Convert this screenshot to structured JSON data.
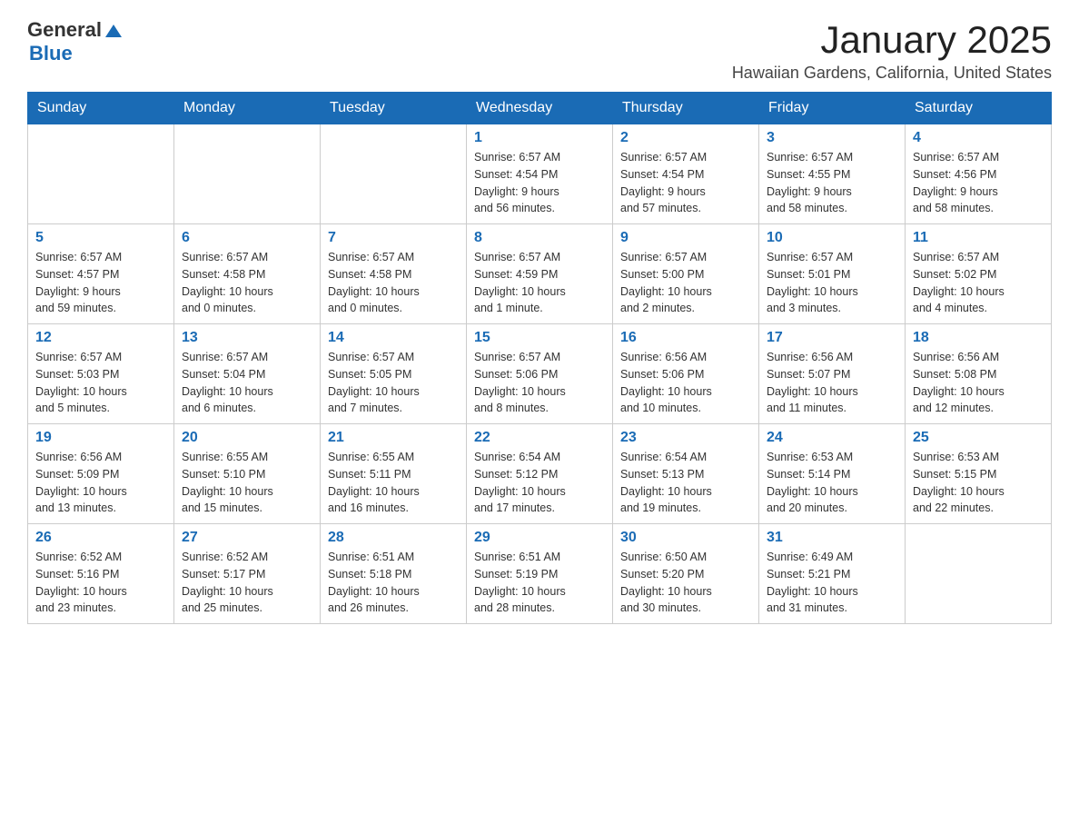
{
  "logo": {
    "text_general": "General",
    "text_blue": "Blue"
  },
  "title": "January 2025",
  "subtitle": "Hawaiian Gardens, California, United States",
  "days_of_week": [
    "Sunday",
    "Monday",
    "Tuesday",
    "Wednesday",
    "Thursday",
    "Friday",
    "Saturday"
  ],
  "weeks": [
    [
      {
        "day": "",
        "info": ""
      },
      {
        "day": "",
        "info": ""
      },
      {
        "day": "",
        "info": ""
      },
      {
        "day": "1",
        "info": "Sunrise: 6:57 AM\nSunset: 4:54 PM\nDaylight: 9 hours\nand 56 minutes."
      },
      {
        "day": "2",
        "info": "Sunrise: 6:57 AM\nSunset: 4:54 PM\nDaylight: 9 hours\nand 57 minutes."
      },
      {
        "day": "3",
        "info": "Sunrise: 6:57 AM\nSunset: 4:55 PM\nDaylight: 9 hours\nand 58 minutes."
      },
      {
        "day": "4",
        "info": "Sunrise: 6:57 AM\nSunset: 4:56 PM\nDaylight: 9 hours\nand 58 minutes."
      }
    ],
    [
      {
        "day": "5",
        "info": "Sunrise: 6:57 AM\nSunset: 4:57 PM\nDaylight: 9 hours\nand 59 minutes."
      },
      {
        "day": "6",
        "info": "Sunrise: 6:57 AM\nSunset: 4:58 PM\nDaylight: 10 hours\nand 0 minutes."
      },
      {
        "day": "7",
        "info": "Sunrise: 6:57 AM\nSunset: 4:58 PM\nDaylight: 10 hours\nand 0 minutes."
      },
      {
        "day": "8",
        "info": "Sunrise: 6:57 AM\nSunset: 4:59 PM\nDaylight: 10 hours\nand 1 minute."
      },
      {
        "day": "9",
        "info": "Sunrise: 6:57 AM\nSunset: 5:00 PM\nDaylight: 10 hours\nand 2 minutes."
      },
      {
        "day": "10",
        "info": "Sunrise: 6:57 AM\nSunset: 5:01 PM\nDaylight: 10 hours\nand 3 minutes."
      },
      {
        "day": "11",
        "info": "Sunrise: 6:57 AM\nSunset: 5:02 PM\nDaylight: 10 hours\nand 4 minutes."
      }
    ],
    [
      {
        "day": "12",
        "info": "Sunrise: 6:57 AM\nSunset: 5:03 PM\nDaylight: 10 hours\nand 5 minutes."
      },
      {
        "day": "13",
        "info": "Sunrise: 6:57 AM\nSunset: 5:04 PM\nDaylight: 10 hours\nand 6 minutes."
      },
      {
        "day": "14",
        "info": "Sunrise: 6:57 AM\nSunset: 5:05 PM\nDaylight: 10 hours\nand 7 minutes."
      },
      {
        "day": "15",
        "info": "Sunrise: 6:57 AM\nSunset: 5:06 PM\nDaylight: 10 hours\nand 8 minutes."
      },
      {
        "day": "16",
        "info": "Sunrise: 6:56 AM\nSunset: 5:06 PM\nDaylight: 10 hours\nand 10 minutes."
      },
      {
        "day": "17",
        "info": "Sunrise: 6:56 AM\nSunset: 5:07 PM\nDaylight: 10 hours\nand 11 minutes."
      },
      {
        "day": "18",
        "info": "Sunrise: 6:56 AM\nSunset: 5:08 PM\nDaylight: 10 hours\nand 12 minutes."
      }
    ],
    [
      {
        "day": "19",
        "info": "Sunrise: 6:56 AM\nSunset: 5:09 PM\nDaylight: 10 hours\nand 13 minutes."
      },
      {
        "day": "20",
        "info": "Sunrise: 6:55 AM\nSunset: 5:10 PM\nDaylight: 10 hours\nand 15 minutes."
      },
      {
        "day": "21",
        "info": "Sunrise: 6:55 AM\nSunset: 5:11 PM\nDaylight: 10 hours\nand 16 minutes."
      },
      {
        "day": "22",
        "info": "Sunrise: 6:54 AM\nSunset: 5:12 PM\nDaylight: 10 hours\nand 17 minutes."
      },
      {
        "day": "23",
        "info": "Sunrise: 6:54 AM\nSunset: 5:13 PM\nDaylight: 10 hours\nand 19 minutes."
      },
      {
        "day": "24",
        "info": "Sunrise: 6:53 AM\nSunset: 5:14 PM\nDaylight: 10 hours\nand 20 minutes."
      },
      {
        "day": "25",
        "info": "Sunrise: 6:53 AM\nSunset: 5:15 PM\nDaylight: 10 hours\nand 22 minutes."
      }
    ],
    [
      {
        "day": "26",
        "info": "Sunrise: 6:52 AM\nSunset: 5:16 PM\nDaylight: 10 hours\nand 23 minutes."
      },
      {
        "day": "27",
        "info": "Sunrise: 6:52 AM\nSunset: 5:17 PM\nDaylight: 10 hours\nand 25 minutes."
      },
      {
        "day": "28",
        "info": "Sunrise: 6:51 AM\nSunset: 5:18 PM\nDaylight: 10 hours\nand 26 minutes."
      },
      {
        "day": "29",
        "info": "Sunrise: 6:51 AM\nSunset: 5:19 PM\nDaylight: 10 hours\nand 28 minutes."
      },
      {
        "day": "30",
        "info": "Sunrise: 6:50 AM\nSunset: 5:20 PM\nDaylight: 10 hours\nand 30 minutes."
      },
      {
        "day": "31",
        "info": "Sunrise: 6:49 AM\nSunset: 5:21 PM\nDaylight: 10 hours\nand 31 minutes."
      },
      {
        "day": "",
        "info": ""
      }
    ]
  ]
}
